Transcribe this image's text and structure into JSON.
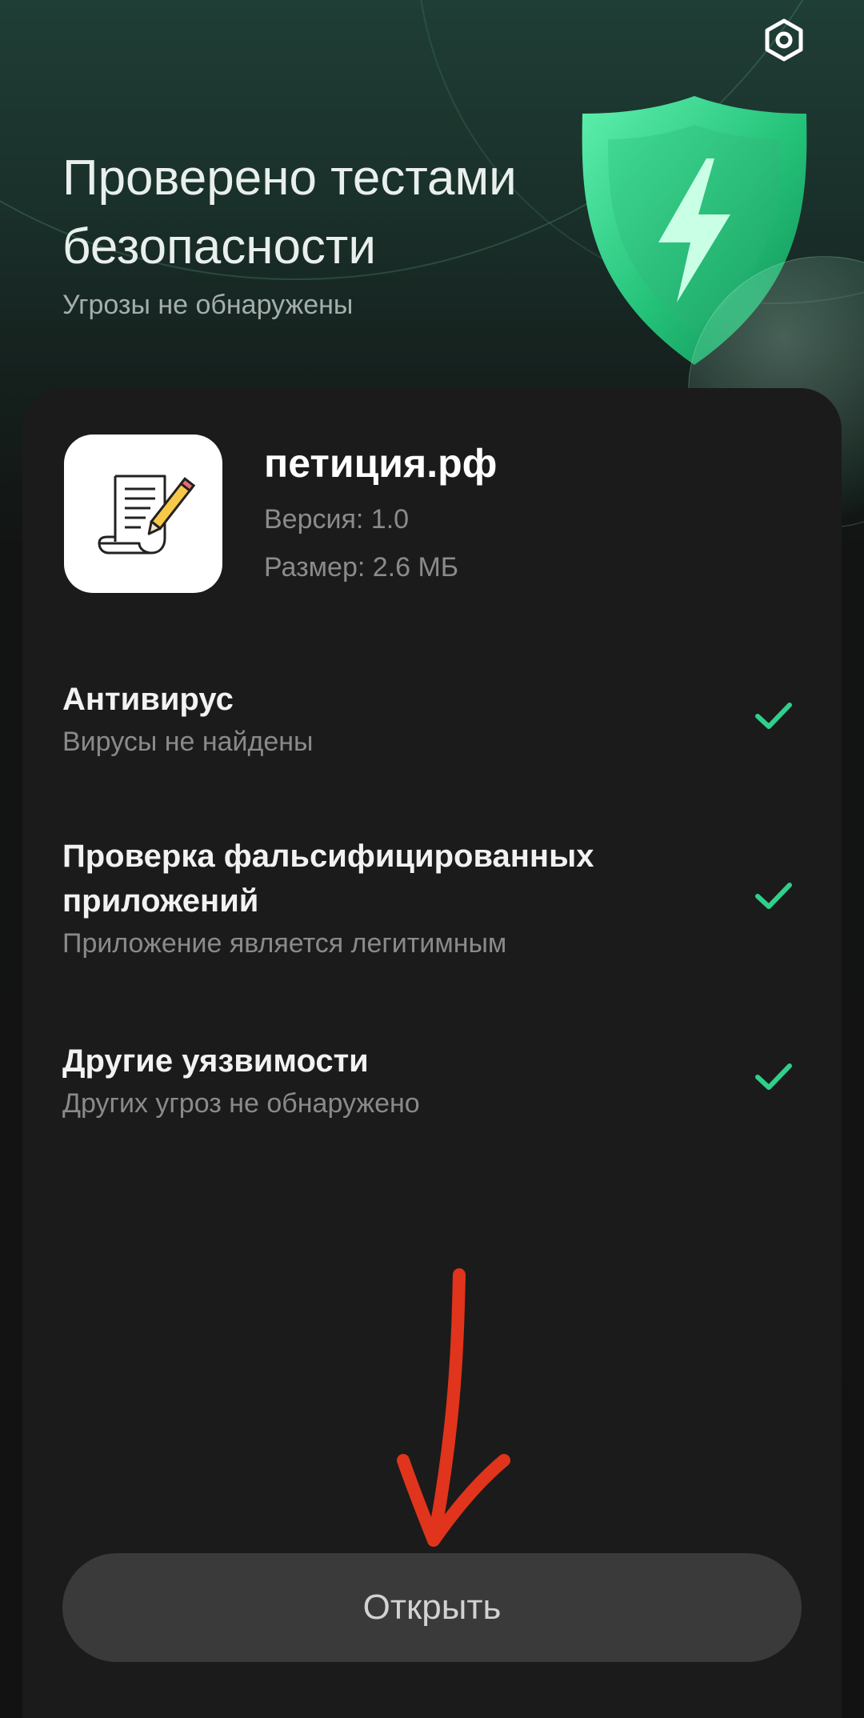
{
  "header": {
    "title": "Проверено тестами безопасности",
    "subtitle": "Угрозы не обнаружены",
    "settings_icon": "settings-gear-icon",
    "shield_icon": "shield-lightning-icon"
  },
  "app": {
    "name": "петиция.рф",
    "version": "Версия: 1.0",
    "size": "Размер: 2.6 МБ",
    "icon": "document-pen-icon"
  },
  "checks": [
    {
      "title": "Антивирус",
      "subtitle": "Вирусы не найдены",
      "status_icon": "check-icon"
    },
    {
      "title": "Проверка фальсифицированных приложений",
      "subtitle": "Приложение является легитимным",
      "status_icon": "check-icon"
    },
    {
      "title": "Другие уязвимости",
      "subtitle": "Других угроз не обнаружено",
      "status_icon": "check-icon"
    }
  ],
  "footer": {
    "open_label": "Открыть"
  },
  "colors": {
    "accent_green": "#2fd08a",
    "annotation_red": "#e0341c",
    "background": "#121212",
    "card": "#1b1b1b"
  }
}
